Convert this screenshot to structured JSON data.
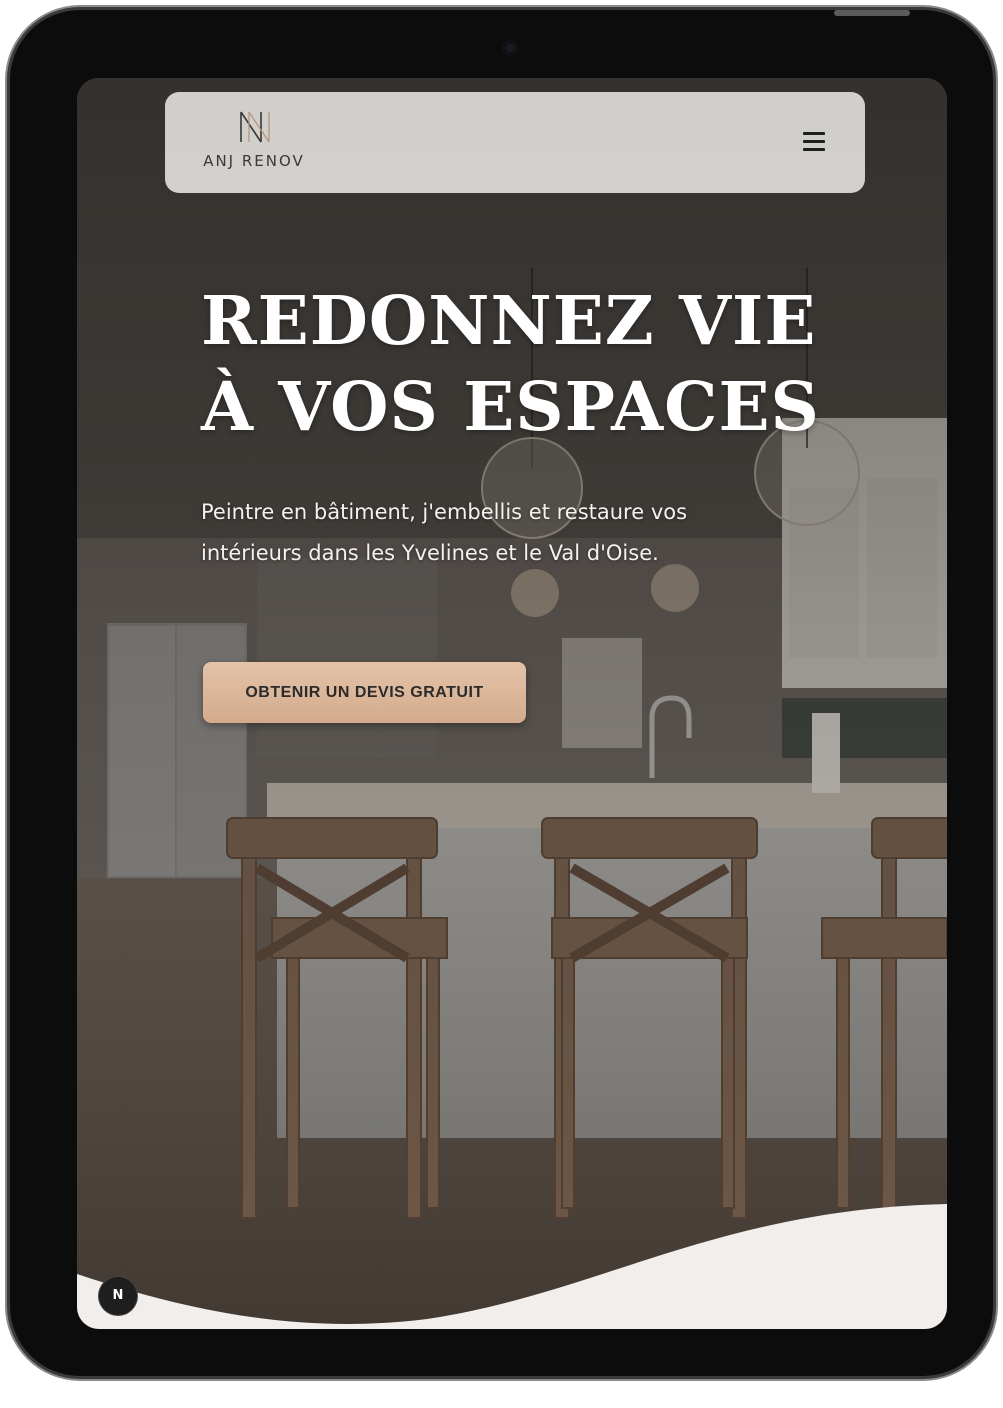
{
  "brand": {
    "name": "ANJ RENOV",
    "mark": "N",
    "mark_icon": "anj-monogram-icon"
  },
  "nav": {
    "menu_icon": "hamburger-menu-icon"
  },
  "hero": {
    "title_line1": "REDONNEZ VIE",
    "title_line2": "À VOS ESPACES",
    "subtitle_line1": "Peintre en bâtiment, j'embellis et restaure vos",
    "subtitle_line2": "intérieurs dans les Yvelines et le Val d'Oise.",
    "cta_label": "OBTENIR UN DEVIS GRATUIT"
  },
  "floating_badge": {
    "label": "N"
  },
  "colors": {
    "cta": "#d9b396",
    "navbar": "#dedbd8",
    "wave": "#f1eeeb",
    "text": "#ffffff"
  }
}
